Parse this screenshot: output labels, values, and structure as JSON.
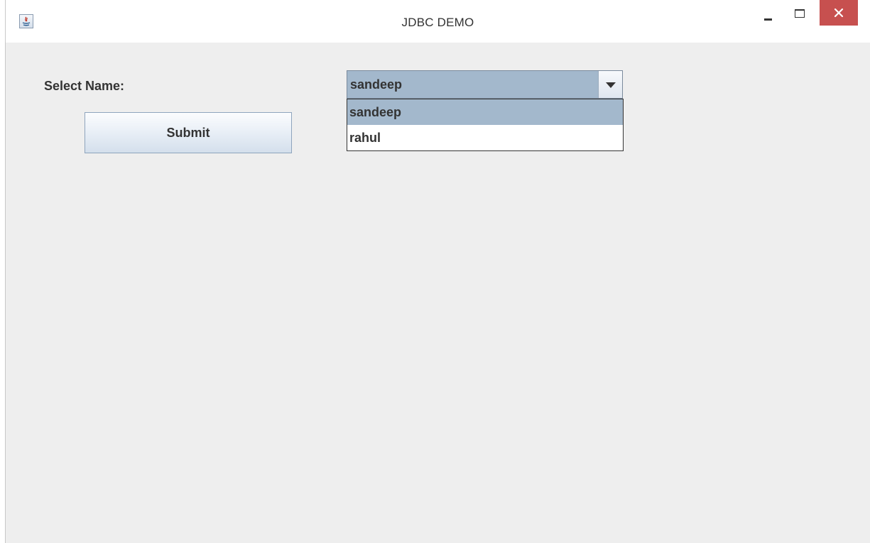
{
  "window": {
    "title": "JDBC DEMO",
    "icon": "java-app-icon",
    "controls": [
      "minimize-icon",
      "maximize-icon",
      "close-icon"
    ],
    "close_color": "#c7504f"
  },
  "form": {
    "label": "Select Name:",
    "submit_label": "Submit",
    "combo": {
      "selected": "sandeep",
      "expanded": true,
      "options": [
        "sandeep",
        "rahul"
      ],
      "highlighted_index": 0,
      "highlight_color": "#a3b8cc"
    }
  }
}
